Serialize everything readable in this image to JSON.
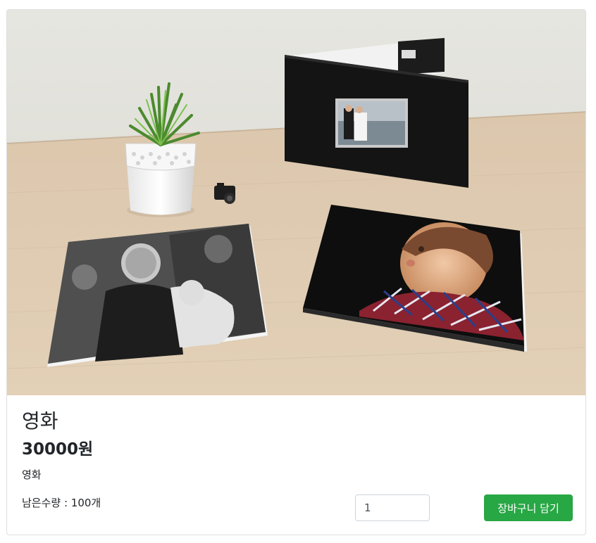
{
  "product": {
    "title": "영화",
    "price": "30000원",
    "description": "영화",
    "stock_text": "남은수량 : 100개",
    "quantity_value": "1",
    "add_to_cart_label": "장바구니 담기"
  },
  "colors": {
    "button_bg": "#28a745",
    "button_text": "#ffffff",
    "card_border": "#dfdfdf"
  }
}
